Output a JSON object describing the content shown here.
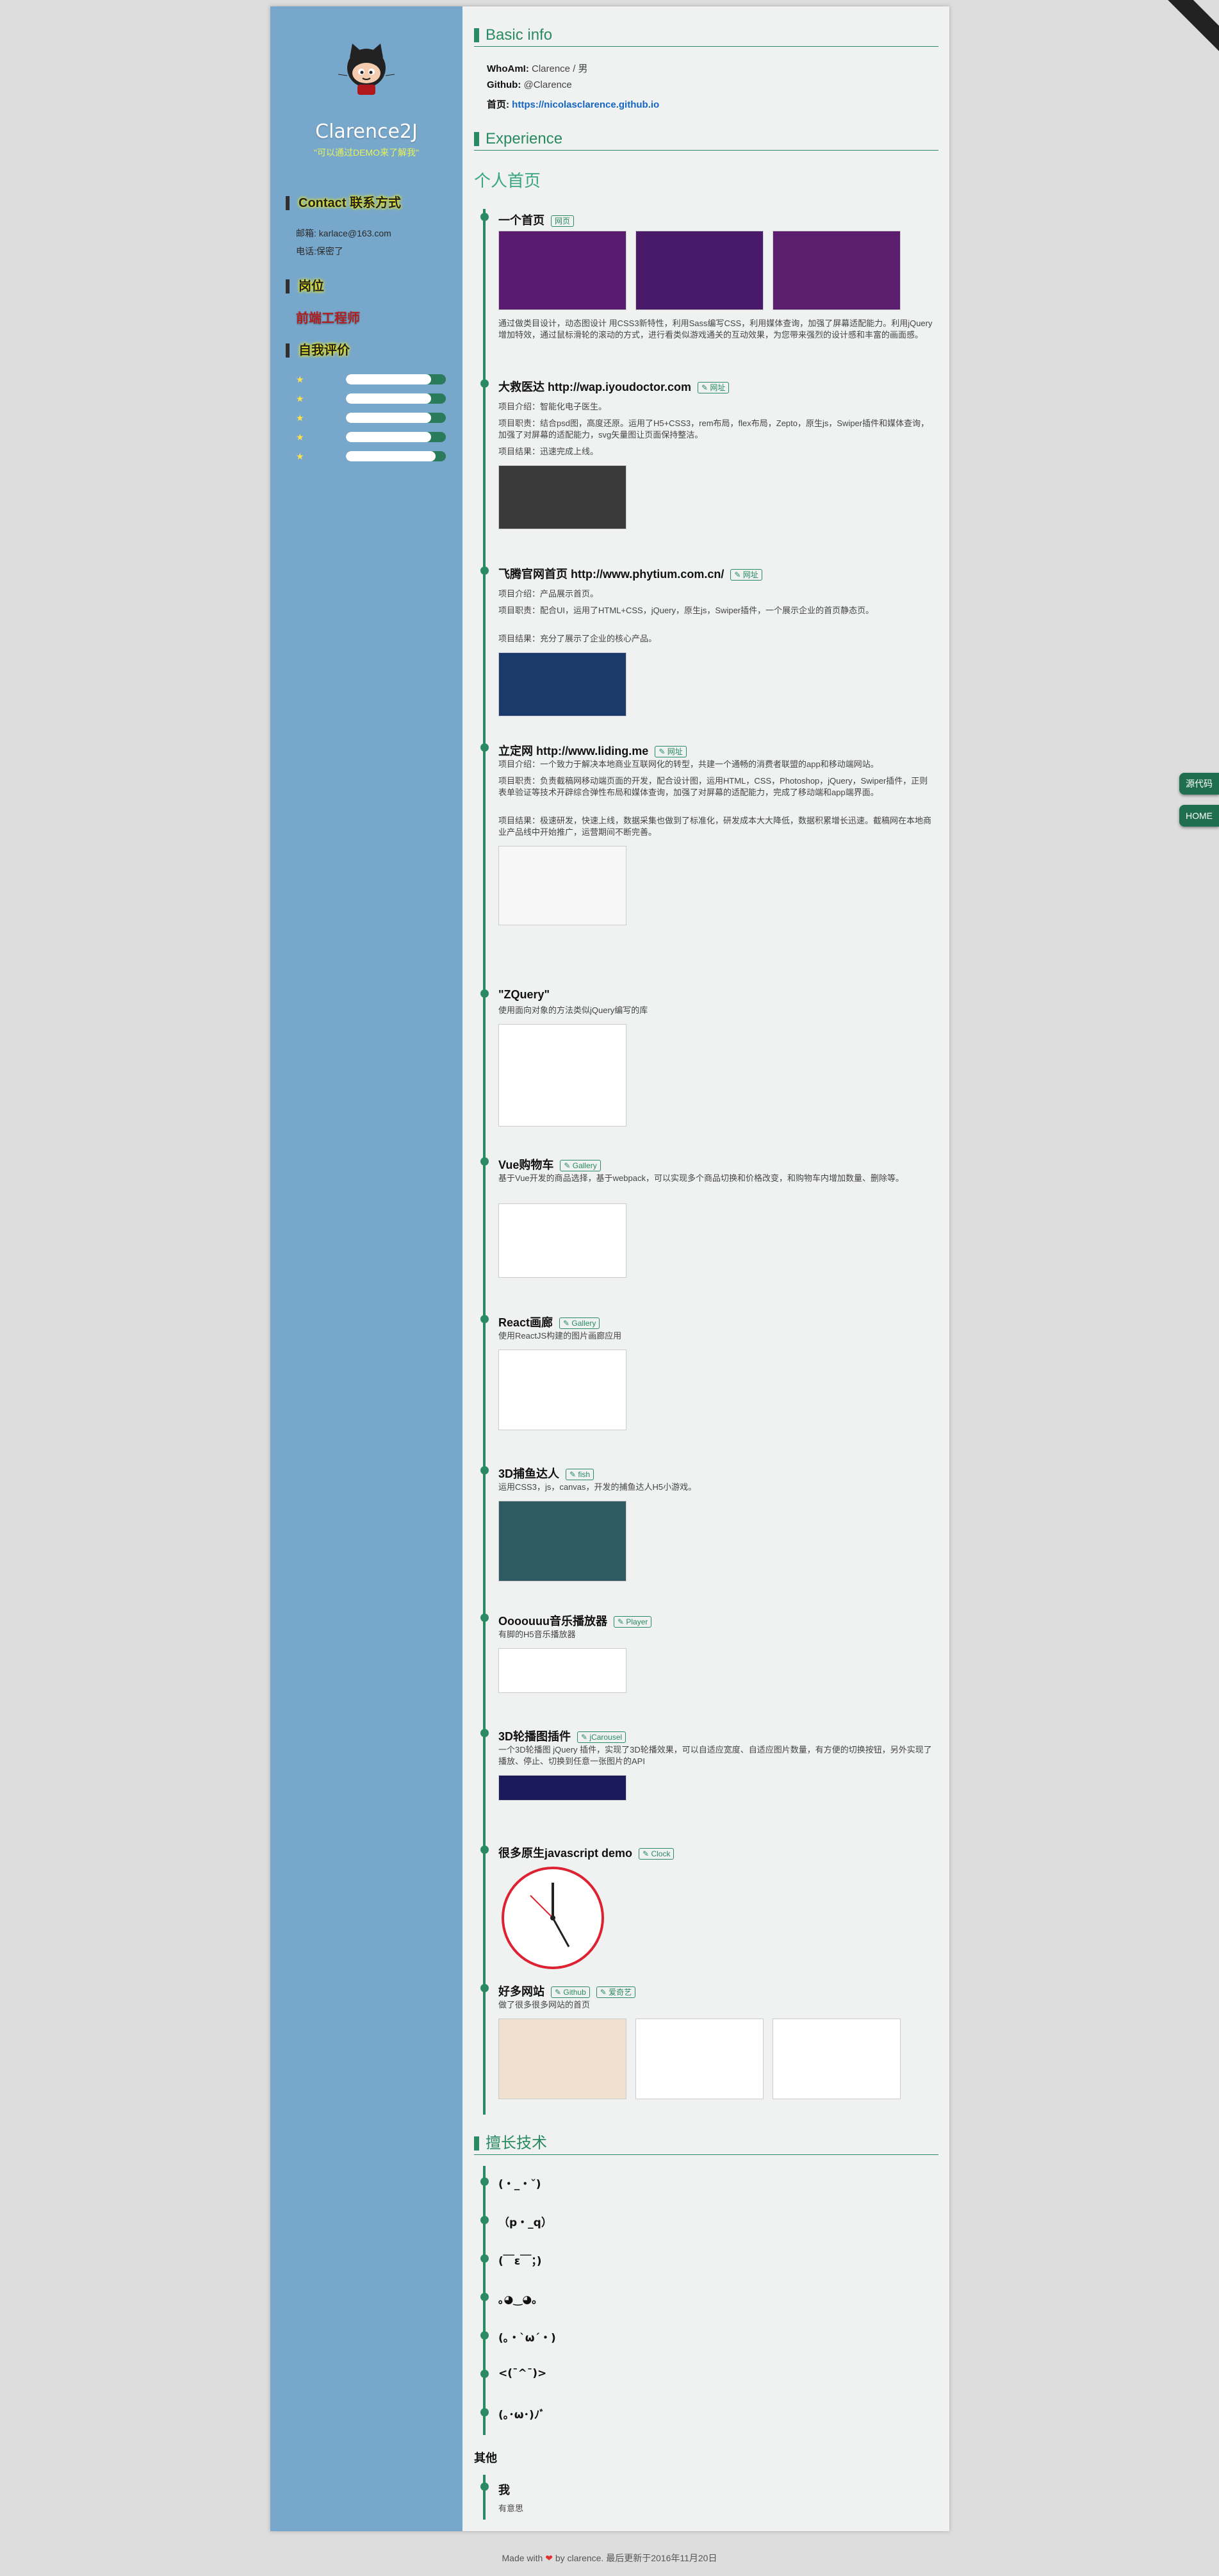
{
  "sidebar": {
    "name": "Clarence2J",
    "motto": "\"可以通过DEMO来了解我\"",
    "contact_title": "Contact 联系方式",
    "email": "邮箱: karlace@163.com",
    "phone": "电话:保密了",
    "job_title": "岗位",
    "job": "前端工程师",
    "eval_title": "自我评价",
    "skills": [
      {
        "icon": "star-icon",
        "level": 0.85
      },
      {
        "icon": "star-icon",
        "level": 0.85
      },
      {
        "icon": "star-icon",
        "level": 0.85
      },
      {
        "icon": "star-icon",
        "level": 0.85
      },
      {
        "icon": "star-icon",
        "level": 0.9
      }
    ]
  },
  "basic": {
    "title": "Basic info",
    "whoami_label": "WhoAmI:",
    "whoami": "Clarence / 男",
    "github_label": "Github:",
    "github": "@Clarence",
    "home_label": "首页:",
    "home_url": "https://nicolasclarence.github.io"
  },
  "experience": {
    "title": "Experience",
    "sub": "个人首页",
    "projects": [
      {
        "name": "一个首页",
        "tag": "网页",
        "lines": [
          "通过做类目设计，动态图设计 用CSS3新特性，利用Sass编写CSS，利用媒体查询，加强了屏幕适配能力。利用jQuery增加特效，通过鼠标滑轮的滚动的方式，进行看类似游戏通关的互动效果，为您带来强烈的设计感和丰富的画面感。"
        ]
      },
      {
        "name": "大救医达 http://wap.iyoudoctor.com",
        "tag": "✎ 网址",
        "lines": [
          "项目介绍：智能化电子医生。",
          "项目职责：结合psd图，高度还原。运用了H5+CSS3，rem布局，flex布局，Zepto，原生js，Swiper插件和媒体查询，加强了对屏幕的适配能力，svg矢量图让页面保持整洁。",
          "项目结果：迅速完成上线。"
        ]
      },
      {
        "name": "飞腾官网首页 http://www.phytium.com.cn/",
        "tag": "✎ 网址",
        "lines": [
          "项目介绍：产品展示首页。",
          "项目职责：配合UI，运用了HTML+CSS，jQuery，原生js，Swiper插件，一个展示企业的首页静态页。",
          "项目结果：充分了展示了企业的核心产品。"
        ]
      },
      {
        "name": "立定网 http://www.liding.me",
        "tag": "✎ 网址",
        "lines": [
          "项目介绍：一个致力于解决本地商业互联网化的转型，共建一个通畅的消费者联盟的app和移动端网站。",
          "项目职责：负责截稿网移动端页面的开发，配合设计图，运用HTML，CSS，Photoshop，jQuery，Swiper插件，正则表单验证等技术开辟综合弹性布局和媒体查询，加强了对屏幕的适配能力，完成了移动端和app端界面。",
          "项目结果：极速研发，快速上线，数据采集也做到了标准化，研发成本大大降低，数据积累增长迅速。截稿网在本地商业产品线中开始推广，运营期间不断完善。"
        ]
      },
      {
        "name": "\"ZQuery\"",
        "tag": "",
        "lines": [
          "使用面向对象的方法类似jQuery编写的库"
        ]
      },
      {
        "name": "Vue购物车",
        "tag": "✎ Gallery",
        "lines": [
          "基于Vue开发的商品选择，基于webpack，可以实现多个商品切换和价格改变，和购物车内增加数量、删除等。"
        ]
      },
      {
        "name": "React画廊",
        "tag": "✎ Gallery",
        "lines": [
          "使用ReactJS构建的图片画廊应用"
        ]
      },
      {
        "name": "3D捕鱼达人",
        "tag": "✎ fish",
        "lines": [
          "运用CSS3，js，canvas，开发的捕鱼达人H5小游戏。"
        ]
      },
      {
        "name": "Oooouuu音乐播放器",
        "tag": "✎ Player",
        "lines": [
          "有脚的H5音乐播放器"
        ]
      },
      {
        "name": "3D轮播图插件",
        "tag": "✎ jCarousel",
        "lines": [
          "一个3D轮播图 jQuery 插件，实现了3D轮播效果，可以自适应宽度、自适应图片数量，有方便的切换按钮，另外实现了播放、停止、切换到任意一张图片的API"
        ]
      },
      {
        "name": "很多原生javascript demo",
        "tag": "✎ Clock",
        "lines": []
      },
      {
        "name": "好多网站",
        "tag": "✎ Github",
        "tag2": "✎ 爱奇艺",
        "lines": [
          "做了很多很多网站的首页"
        ]
      }
    ]
  },
  "skills_section": {
    "title": "擅长技术",
    "items": [
      "(・_・ˇ)",
      "（p・_q）",
      "(￣ε￣；)",
      "｡◕‿◕｡",
      "(｡・`ω´・)",
      "<(ˉ^ˉ)>",
      "(｡･ω･)ﾉﾞ"
    ]
  },
  "other": {
    "title": "其他",
    "item_title": "我",
    "item_text": "有意思"
  },
  "footer": {
    "pre": "Made with",
    "heart": "❤",
    "post": "by clarence. 最后更新于2016年11月20日"
  },
  "float": {
    "source": "源代码",
    "home": "HOME"
  },
  "colors": {
    "sidebar": "#77a7cb",
    "accent": "#2a8a63",
    "background": "#dddddd",
    "panel": "#eff2f1"
  }
}
